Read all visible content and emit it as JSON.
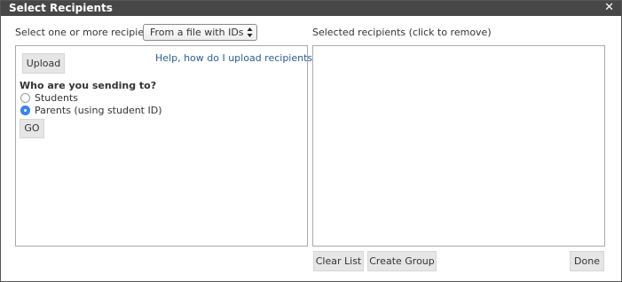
{
  "dialog": {
    "title": "Select Recipients",
    "close_glyph": "✕"
  },
  "source": {
    "label": "Select one or more recipients",
    "selected_option": "From a file with IDs"
  },
  "upload_panel": {
    "upload_button": "Upload",
    "help_link": "Help, how do I upload recipients",
    "help_icon": "question-circle-icon",
    "question": "Who are you sending to?",
    "options": [
      {
        "label": "Students",
        "selected": false
      },
      {
        "label": "Parents (using student ID)",
        "selected": true
      }
    ],
    "go_button": "GO"
  },
  "selected_panel": {
    "label": "Selected recipients (click to remove)"
  },
  "footer": {
    "clear_button": "Clear List",
    "create_group_button": "Create Group",
    "done_button": "Done"
  },
  "colors": {
    "titlebar": "#474747",
    "link": "#2a5c95",
    "radio_selected": "#3b86f0",
    "button_bg": "#e6e6e6"
  }
}
